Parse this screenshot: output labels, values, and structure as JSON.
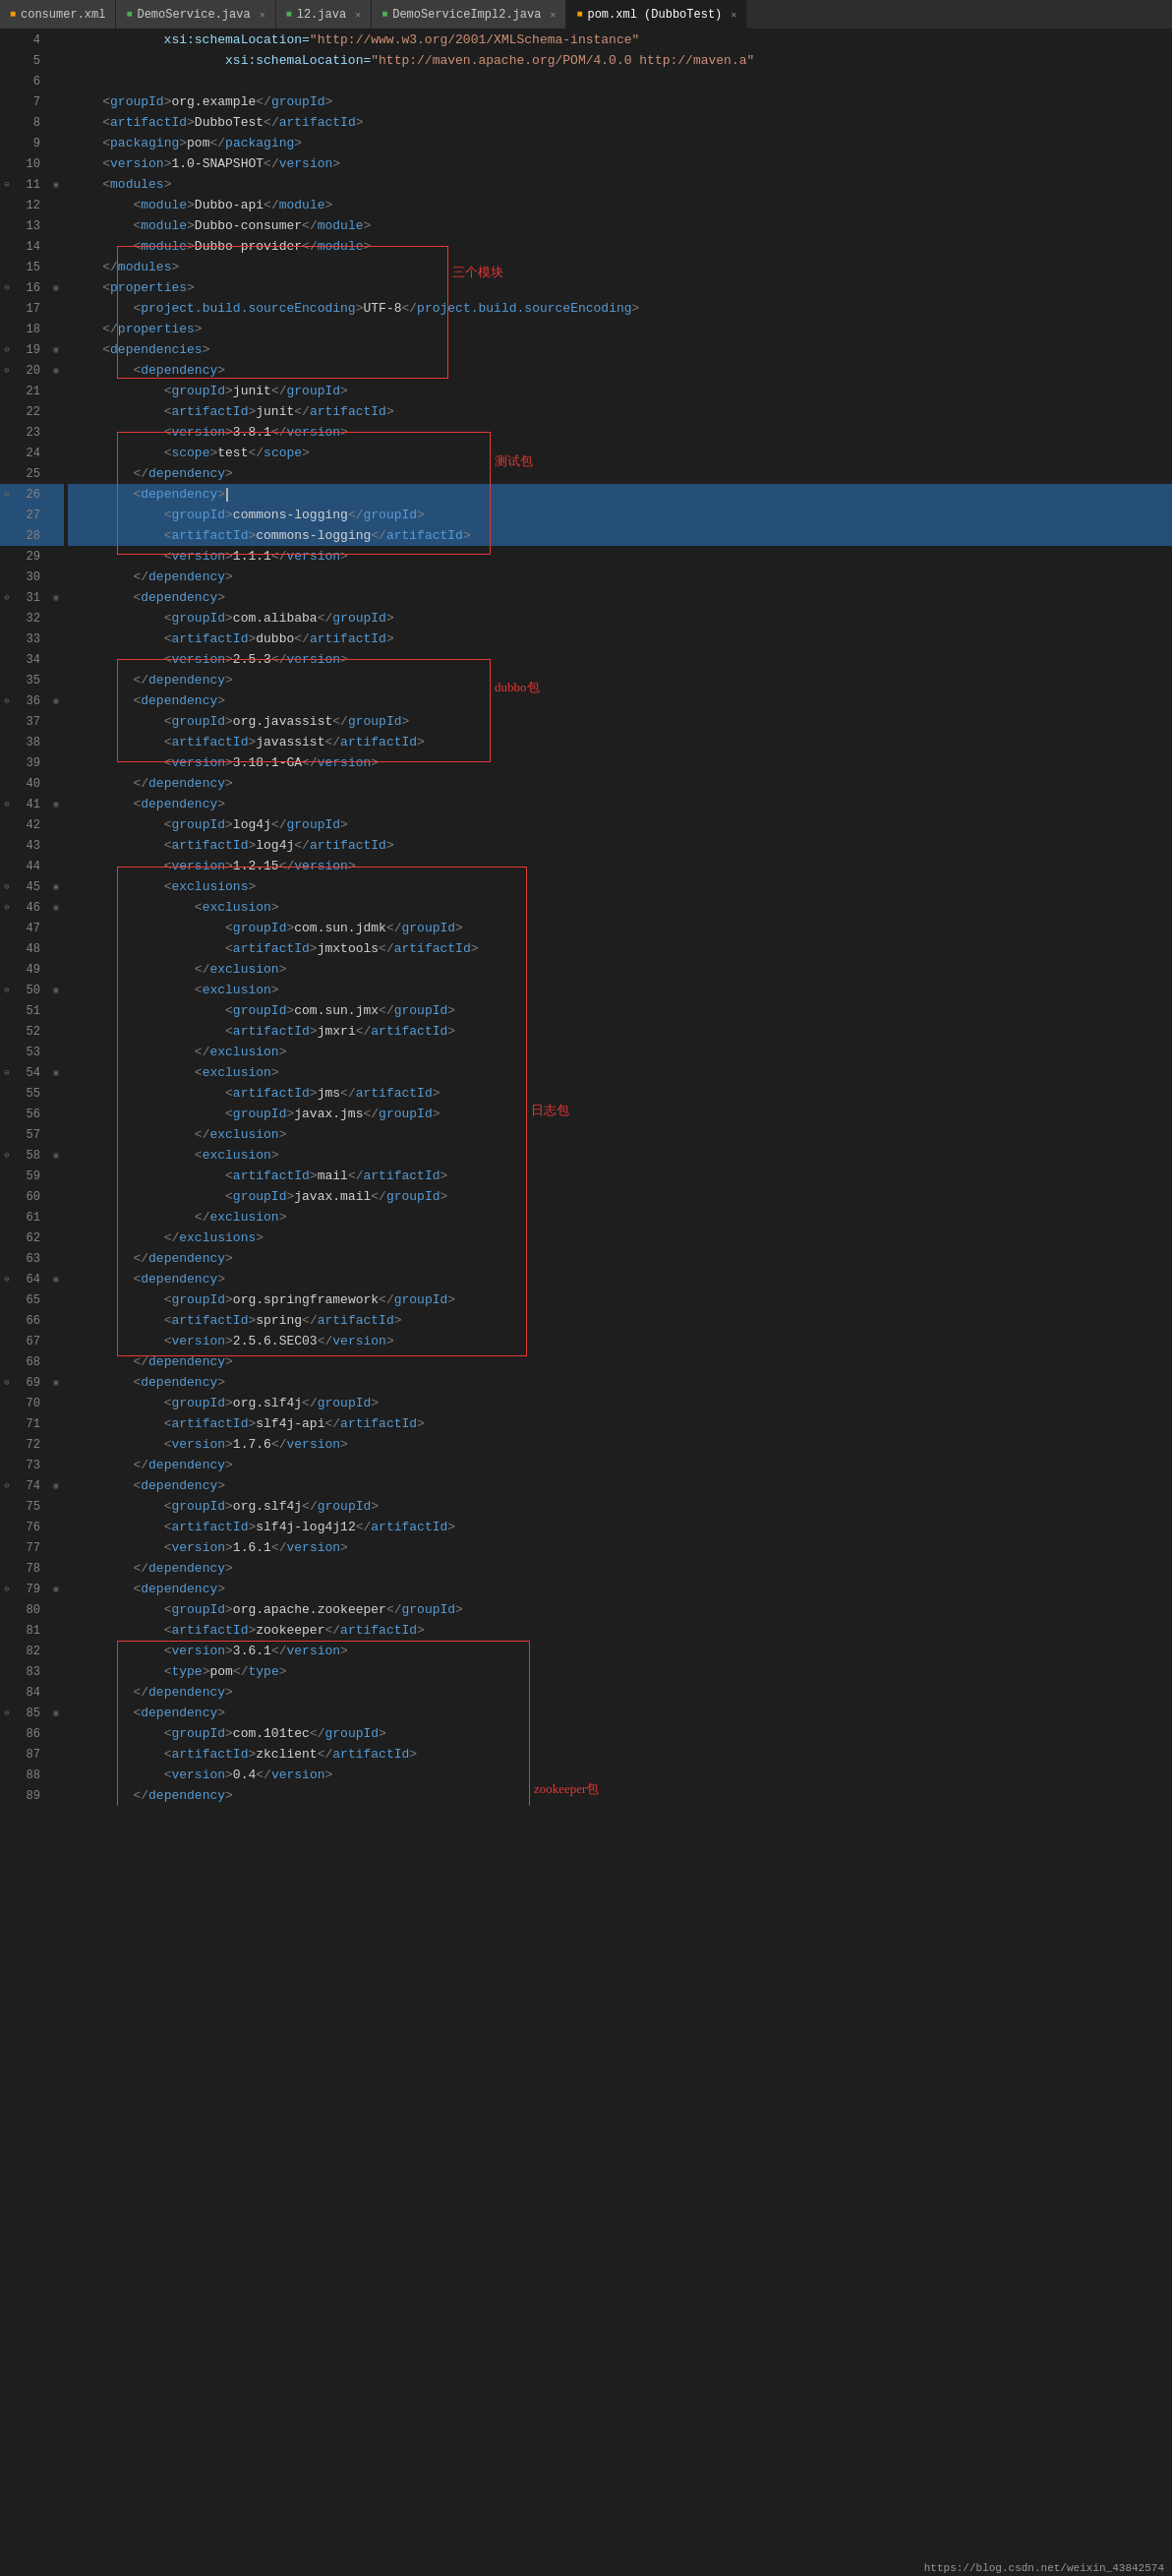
{
  "tabs": [
    {
      "id": "consumer-xml",
      "label": "consumer.xml",
      "color": "#ff9800",
      "active": false,
      "closable": false
    },
    {
      "id": "demo-service-java",
      "label": "DemoService.java",
      "color": "#4caf50",
      "active": false,
      "closable": true
    },
    {
      "id": "l2-java",
      "label": "l2.java",
      "color": "#4caf50",
      "active": false,
      "closable": true
    },
    {
      "id": "demo-service-impl2",
      "label": "DemoServiceImpl2.java",
      "color": "#4caf50",
      "active": false,
      "closable": true
    },
    {
      "id": "pom-xml",
      "label": "pom.xml (DubboTest)",
      "color": "#ff9800",
      "active": true,
      "closable": true
    }
  ],
  "lines": [
    {
      "num": 4,
      "indent": 2,
      "content": "xsi:schemaLocation=\"http://www.w3.org/2001/XMLSchema-instance",
      "highlighted": false,
      "foldable": false
    },
    {
      "num": 5,
      "indent": 4,
      "content": "xsi:schemaLocation=\"http://maven.apache.org/POM/4.0.0 http://maven.a",
      "highlighted": false,
      "foldable": false
    },
    {
      "num": 6,
      "indent": 1,
      "content": "",
      "highlighted": false
    },
    {
      "num": 7,
      "indent": 2,
      "content": "<groupId>org.example</groupId>",
      "highlighted": false
    },
    {
      "num": 8,
      "indent": 2,
      "content": "<artifactId>DubboTest</artifactId>",
      "highlighted": false
    },
    {
      "num": 9,
      "indent": 2,
      "content": "<packaging>pom</packaging>",
      "highlighted": false
    },
    {
      "num": 10,
      "indent": 2,
      "content": "<version>1.0-SNAPSHOT</version>",
      "highlighted": false
    },
    {
      "num": 11,
      "indent": 2,
      "content": "<modules>",
      "highlighted": false,
      "foldable": true
    },
    {
      "num": 12,
      "indent": 3,
      "content": "<module>Dubbo-api</module>",
      "highlighted": false
    },
    {
      "num": 13,
      "indent": 3,
      "content": "<module>Dubbo-consumer</module>",
      "highlighted": false
    },
    {
      "num": 14,
      "indent": 3,
      "content": "<module>Dubbo-provider</module>",
      "highlighted": false
    },
    {
      "num": 15,
      "indent": 2,
      "content": "</modules>",
      "highlighted": false
    },
    {
      "num": 16,
      "indent": 2,
      "content": "<properties>",
      "highlighted": false,
      "foldable": true
    },
    {
      "num": 17,
      "indent": 3,
      "content": "<project.build.sourceEncoding>UTF-8</project.build.sourceEncoding>",
      "highlighted": false
    },
    {
      "num": 18,
      "indent": 2,
      "content": "</properties>",
      "highlighted": false
    },
    {
      "num": 19,
      "indent": 2,
      "content": "<dependencies>",
      "highlighted": false,
      "foldable": true
    },
    {
      "num": 20,
      "indent": 3,
      "content": "<dependency>",
      "highlighted": false,
      "foldable": true
    },
    {
      "num": 21,
      "indent": 4,
      "content": "<groupId>junit</groupId>",
      "highlighted": false
    },
    {
      "num": 22,
      "indent": 4,
      "content": "<artifactId>junit</artifactId>",
      "highlighted": false
    },
    {
      "num": 23,
      "indent": 4,
      "content": "<version>3.8.1</version>",
      "highlighted": false
    },
    {
      "num": 24,
      "indent": 4,
      "content": "<scope>test</scope>",
      "highlighted": false
    },
    {
      "num": 25,
      "indent": 3,
      "content": "</dependency>",
      "highlighted": false
    },
    {
      "num": 26,
      "indent": 3,
      "content": "<dependency>",
      "highlighted": true,
      "foldable": true
    },
    {
      "num": 27,
      "indent": 4,
      "content": "<groupId>commons-logging</groupId>",
      "highlighted": true
    },
    {
      "num": 28,
      "indent": 4,
      "content": "<artifactId>commons-logging</artifactId>",
      "highlighted": true
    },
    {
      "num": 29,
      "indent": 4,
      "content": "<version>1.1.1</version>",
      "highlighted": false
    },
    {
      "num": 30,
      "indent": 3,
      "content": "</dependency>",
      "highlighted": false
    },
    {
      "num": 31,
      "indent": 3,
      "content": "<dependency>",
      "highlighted": false,
      "foldable": true
    },
    {
      "num": 32,
      "indent": 4,
      "content": "<groupId>com.alibaba</groupId>",
      "highlighted": false
    },
    {
      "num": 33,
      "indent": 4,
      "content": "<artifactId>dubbo</artifactId>",
      "highlighted": false
    },
    {
      "num": 34,
      "indent": 4,
      "content": "<version>2.5.3</version>",
      "highlighted": false
    },
    {
      "num": 35,
      "indent": 3,
      "content": "</dependency>",
      "highlighted": false
    },
    {
      "num": 36,
      "indent": 3,
      "content": "<dependency>",
      "highlighted": false,
      "foldable": true
    },
    {
      "num": 37,
      "indent": 4,
      "content": "<groupId>org.javassist</groupId>",
      "highlighted": false
    },
    {
      "num": 38,
      "indent": 4,
      "content": "<artifactId>javassist</artifactId>",
      "highlighted": false
    },
    {
      "num": 39,
      "indent": 4,
      "content": "<version>3.18.1-GA</version>",
      "highlighted": false
    },
    {
      "num": 40,
      "indent": 3,
      "content": "</dependency>",
      "highlighted": false
    },
    {
      "num": 41,
      "indent": 3,
      "content": "<dependency>",
      "highlighted": false,
      "foldable": true
    },
    {
      "num": 42,
      "indent": 4,
      "content": "<groupId>log4j</groupId>",
      "highlighted": false
    },
    {
      "num": 43,
      "indent": 4,
      "content": "<artifactId>log4j</artifactId>",
      "highlighted": false
    },
    {
      "num": 44,
      "indent": 4,
      "content": "<version>1.2.15</version>",
      "highlighted": false
    },
    {
      "num": 45,
      "indent": 4,
      "content": "<exclusions>",
      "highlighted": false,
      "foldable": true
    },
    {
      "num": 46,
      "indent": 5,
      "content": "<exclusion>",
      "highlighted": false,
      "foldable": true
    },
    {
      "num": 47,
      "indent": 6,
      "content": "<groupId>com.sun.jdmk</groupId>",
      "highlighted": false
    },
    {
      "num": 48,
      "indent": 6,
      "content": "<artifactId>jmxtools</artifactId>",
      "highlighted": false
    },
    {
      "num": 49,
      "indent": 5,
      "content": "</exclusion>",
      "highlighted": false
    },
    {
      "num": 50,
      "indent": 5,
      "content": "<exclusion>",
      "highlighted": false,
      "foldable": true
    },
    {
      "num": 51,
      "indent": 6,
      "content": "<groupId>com.sun.jmx</groupId>",
      "highlighted": false
    },
    {
      "num": 52,
      "indent": 6,
      "content": "<artifactId>jmxri</artifactId>",
      "highlighted": false
    },
    {
      "num": 53,
      "indent": 5,
      "content": "</exclusion>",
      "highlighted": false
    },
    {
      "num": 54,
      "indent": 5,
      "content": "<exclusion>",
      "highlighted": false,
      "foldable": true
    },
    {
      "num": 55,
      "indent": 6,
      "content": "<artifactId>jms</artifactId>",
      "highlighted": false
    },
    {
      "num": 56,
      "indent": 6,
      "content": "<groupId>javax.jms</groupId>",
      "highlighted": false
    },
    {
      "num": 57,
      "indent": 5,
      "content": "</exclusion>",
      "highlighted": false
    },
    {
      "num": 58,
      "indent": 5,
      "content": "<exclusion>",
      "highlighted": false,
      "foldable": true
    },
    {
      "num": 59,
      "indent": 6,
      "content": "<artifactId>mail</artifactId>",
      "highlighted": false
    },
    {
      "num": 60,
      "indent": 6,
      "content": "<groupId>javax.mail</groupId>",
      "highlighted": false
    },
    {
      "num": 61,
      "indent": 5,
      "content": "</exclusion>",
      "highlighted": false
    },
    {
      "num": 62,
      "indent": 4,
      "content": "</exclusions>",
      "highlighted": false
    },
    {
      "num": 63,
      "indent": 3,
      "content": "</dependency>",
      "highlighted": false
    },
    {
      "num": 64,
      "indent": 3,
      "content": "<dependency>",
      "highlighted": false,
      "foldable": true
    },
    {
      "num": 65,
      "indent": 4,
      "content": "<groupId>org.springframework</groupId>",
      "highlighted": false
    },
    {
      "num": 66,
      "indent": 4,
      "content": "<artifactId>spring</artifactId>",
      "highlighted": false
    },
    {
      "num": 67,
      "indent": 4,
      "content": "<version>2.5.6.SEC03</version>",
      "highlighted": false
    },
    {
      "num": 68,
      "indent": 3,
      "content": "</dependency>",
      "highlighted": false
    },
    {
      "num": 69,
      "indent": 3,
      "content": "<dependency>",
      "highlighted": false,
      "foldable": true
    },
    {
      "num": 70,
      "indent": 4,
      "content": "<groupId>org.slf4j</groupId>",
      "highlighted": false
    },
    {
      "num": 71,
      "indent": 4,
      "content": "<artifactId>slf4j-api</artifactId>",
      "highlighted": false
    },
    {
      "num": 72,
      "indent": 4,
      "content": "<version>1.7.6</version>",
      "highlighted": false
    },
    {
      "num": 73,
      "indent": 3,
      "content": "</dependency>",
      "highlighted": false
    },
    {
      "num": 74,
      "indent": 3,
      "content": "<dependency>",
      "highlighted": false,
      "foldable": true
    },
    {
      "num": 75,
      "indent": 4,
      "content": "<groupId>org.slf4j</groupId>",
      "highlighted": false
    },
    {
      "num": 76,
      "indent": 4,
      "content": "<artifactId>slf4j-log4j12</artifactId>",
      "highlighted": false
    },
    {
      "num": 77,
      "indent": 4,
      "content": "<version>1.6.1</version>",
      "highlighted": false
    },
    {
      "num": 78,
      "indent": 3,
      "content": "</dependency>",
      "highlighted": false
    },
    {
      "num": 79,
      "indent": 3,
      "content": "<dependency>",
      "highlighted": false,
      "foldable": true
    },
    {
      "num": 80,
      "indent": 4,
      "content": "<groupId>org.apache.zookeeper</groupId>",
      "highlighted": false
    },
    {
      "num": 81,
      "indent": 4,
      "content": "<artifactId>zookeeper</artifactId>",
      "highlighted": false
    },
    {
      "num": 82,
      "indent": 4,
      "content": "<version>3.6.1</version>",
      "highlighted": false
    },
    {
      "num": 83,
      "indent": 4,
      "content": "<type>pom</type>",
      "highlighted": false
    },
    {
      "num": 84,
      "indent": 3,
      "content": "</dependency>",
      "highlighted": false
    },
    {
      "num": 85,
      "indent": 3,
      "content": "<dependency>",
      "highlighted": false,
      "foldable": true
    },
    {
      "num": 86,
      "indent": 4,
      "content": "<groupId>com.101tec</groupId>",
      "highlighted": false
    },
    {
      "num": 87,
      "indent": 4,
      "content": "<artifactId>zkclient</artifactId>",
      "highlighted": false
    },
    {
      "num": 88,
      "indent": 4,
      "content": "<version>0.4</version>",
      "highlighted": false
    },
    {
      "num": 89,
      "indent": 3,
      "content": "</dependency>",
      "highlighted": false
    }
  ],
  "annotations": [
    {
      "id": "modules-box",
      "label": "三个模块",
      "label_right": true
    },
    {
      "id": "test-box",
      "label": "测试包",
      "label_right": true
    },
    {
      "id": "dubbo-box",
      "label": "dubbo包",
      "label_right": true
    },
    {
      "id": "log-box",
      "label": "日志包",
      "label_right": true
    },
    {
      "id": "zookeeper-box",
      "label": "zookeeper包",
      "label_right": true
    }
  ],
  "status_bar": {
    "url": "https://blog.csdn.net/weixin_43842574"
  }
}
